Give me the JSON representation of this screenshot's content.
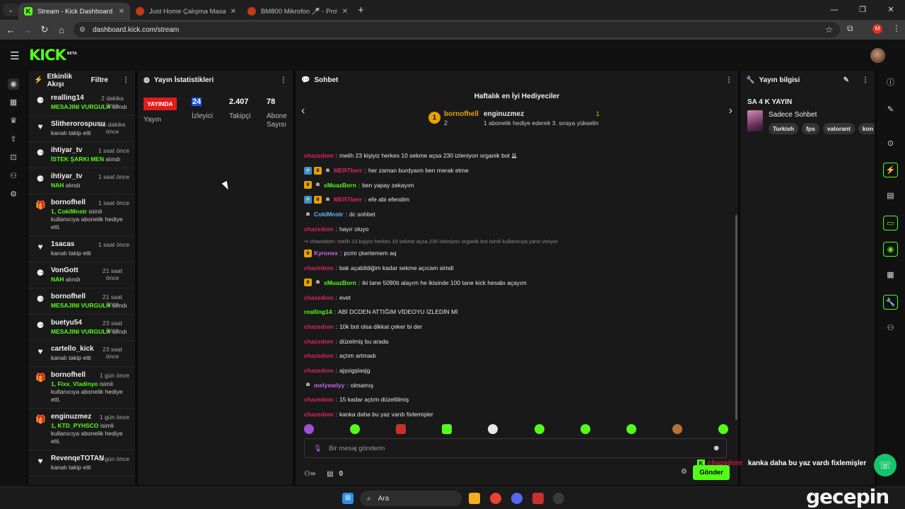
{
  "browser": {
    "tabs": [
      {
        "title": "Stream - Kick Dashboard",
        "active": true
      },
      {
        "title": "Just Home Çalışma Masası - Be",
        "active": false
      },
      {
        "title": "BM800 Mikrofon 🎤 - Profesyo",
        "active": false
      }
    ],
    "url": "dashboard.kick.com/stream",
    "profile_initial": "M"
  },
  "brand": {
    "logo": "KICK",
    "badge": "BETA",
    "accent": "#53fc18"
  },
  "activity": {
    "title": "Etkinlik Akışı",
    "filter_label": "Filtre",
    "events": [
      {
        "icon": "sub-icon",
        "name": "realling14",
        "time": "2 dakika önce",
        "detail": "MESAJINI VURGULA",
        "suffix": " alındı"
      },
      {
        "icon": "heart-icon",
        "name": "Slitherorospusu",
        "time": "25 dakika önce",
        "detail": "",
        "suffix": "kanalı takip etti"
      },
      {
        "icon": "sub-icon",
        "name": "ihtiyar_tv",
        "time": "1 saat önce",
        "detail": "İSTEK ŞARKI MEN",
        "suffix": " alındı"
      },
      {
        "icon": "sub-icon",
        "name": "ihtiyar_tv",
        "time": "1 saat önce",
        "detail": "NAH",
        "suffix": " alındı"
      },
      {
        "icon": "gift-icon",
        "name": "bornofhell",
        "time": "1 saat önce",
        "detail": "1, CokiMnstr",
        "suffix": " isimli kullanıcıya abonelik hediye etti."
      },
      {
        "icon": "heart-icon",
        "name": "1sacas",
        "time": "1 saat önce",
        "detail": "",
        "suffix": "kanalı takip etti"
      },
      {
        "icon": "sub-icon",
        "name": "VonGott",
        "time": "21 saat önce",
        "detail": "NAH",
        "suffix": " alındı"
      },
      {
        "icon": "sub-icon",
        "name": "bornofhell",
        "time": "21 saat önce",
        "detail": "MESAJINI VURGULA",
        "suffix": " alındı"
      },
      {
        "icon": "sub-icon",
        "name": "buetyu54",
        "time": "23 saat önce",
        "detail": "MESAJINI VURGULA",
        "suffix": " alındı"
      },
      {
        "icon": "heart-icon",
        "name": "cartello_kick",
        "time": "23 saat önce",
        "detail": "",
        "suffix": "kanalı takip etti"
      },
      {
        "icon": "gift-icon",
        "name": "bornofhell",
        "time": "1 gün önce",
        "detail": "1, Fixx_Vladinyo",
        "suffix": " isimli kullanıcıya abonelik hediye etti."
      },
      {
        "icon": "gift-icon",
        "name": "enginuzmez",
        "time": "1 gün önce",
        "detail": "1, KTD_PYHSCO",
        "suffix": " isimli kullanıcıya abonelik hediye etti."
      },
      {
        "icon": "heart-icon",
        "name": "RevenqeTOTAN",
        "time": "1 gün önce",
        "detail": "",
        "suffix": "kanalı takip etti"
      }
    ]
  },
  "stats": {
    "title": "Yayın İstatistikleri",
    "live_label": "YAYINDA",
    "live_sub": "Yayın",
    "viewers": "24",
    "viewers_label": "İzleyici",
    "followers": "2.407",
    "followers_label": "Takipçi",
    "subs": "78",
    "subs_label": "Abone Sayısı"
  },
  "chat": {
    "title": "Sohbet",
    "top_gifters_title": "Haftalık en İyi Hediyeciler",
    "leader": {
      "rank": "1",
      "name": "bornofhell",
      "count": "2"
    },
    "second": {
      "name": "enginuzmez",
      "count": "1",
      "note": "1 abonelik hediye ederek 3. sıraya yükselin"
    },
    "messages": [
      {
        "user": "chazedom",
        "color": "#e0245e",
        "badges": [],
        "text": "melih 23 kişiyiz herkes 10 sekme açsa 230 izleniyon organik bot"
      },
      {
        "user": "MERTberr",
        "color": "#e0245e",
        "badges": [
          "blue",
          "gold",
          "gray"
        ],
        "text": "her zaman burdyaım ben merak etme"
      },
      {
        "user": "xMuazBorn",
        "color": "#53fc18",
        "badges": [
          "gold",
          "gray"
        ],
        "text": "ben yapay zekayım"
      },
      {
        "user": "MERTberr",
        "color": "#e0245e",
        "badges": [
          "blue",
          "gold",
          "gray"
        ],
        "text": "efe abi efendim"
      },
      {
        "user": "CokiMnstr",
        "color": "#66b3ff",
        "badges": [
          "gray"
        ],
        "text": "dc sohbet"
      },
      {
        "user": "chazedom",
        "color": "#e0245e",
        "badges": [],
        "text": "hayır oluyo"
      },
      {
        "reply": true,
        "text": "↪ chazedom: melih 23 kişiyiz herkes 10 sekme açsa 230 izleniyon organik bot isimli kullanıcıya yanıt veriyor"
      },
      {
        "user": "Kyronex",
        "color": "#c467e6",
        "badges": [
          "gold"
        ],
        "text": "pcmi çkertemem aq"
      },
      {
        "user": "chazedom",
        "color": "#e0245e",
        "badges": [],
        "text": "bak açabildiğim kadar sekme açıcam simdi"
      },
      {
        "user": "xMuazBorn",
        "color": "#53fc18",
        "badges": [
          "gold",
          "gray"
        ],
        "text": "iki tane 5090ti alayım he ikisinde 100 tane kick hesabı açayım"
      },
      {
        "user": "chazedom",
        "color": "#e0245e",
        "badges": [],
        "text": "evet"
      },
      {
        "user": "realling14",
        "color": "#53fc18",
        "badges": [],
        "text": "ABİ DCDEN ATTIĞIM VİDEOYU İZLEDİN Mİ"
      },
      {
        "user": "chazedom",
        "color": "#e0245e",
        "badges": [],
        "text": "10k bot olsa dikkat çeker bi der"
      },
      {
        "user": "chazedom",
        "color": "#e0245e",
        "badges": [],
        "text": "düzelmiş bu arada"
      },
      {
        "user": "chazedom",
        "color": "#e0245e",
        "badges": [],
        "text": "açtım artmadı"
      },
      {
        "user": "chazedom",
        "color": "#e0245e",
        "badges": [],
        "text": "ajşsigşlasjg"
      },
      {
        "user": "melymelyy",
        "color": "#c467e6",
        "badges": [
          "gray"
        ],
        "text": "olmamış"
      },
      {
        "user": "chazedom",
        "color": "#e0245e",
        "badges": [],
        "text": "15 kadar açtım düzeltilmiş"
      },
      {
        "user": "chazedom",
        "color": "#e0245e",
        "badges": [],
        "text": "kanka daha bu yaz vardı fixlemişler"
      }
    ],
    "input_placeholder": "Bir mesaj gönderin",
    "points": "0",
    "send_label": "Gönder"
  },
  "info": {
    "title": "Yayın bilgisi",
    "stream_title": "SA 4 K YAYIN",
    "category": "Sadece Sohbet",
    "tags": [
      "Turkish",
      "fps",
      "valorant",
      "kon"
    ]
  },
  "overlay": {
    "user": "chazedom",
    "text": "kanka daha bu yaz vardı fixlemişler"
  },
  "taskbar": {
    "search_label": "Ara"
  },
  "watermark": "gecepin"
}
